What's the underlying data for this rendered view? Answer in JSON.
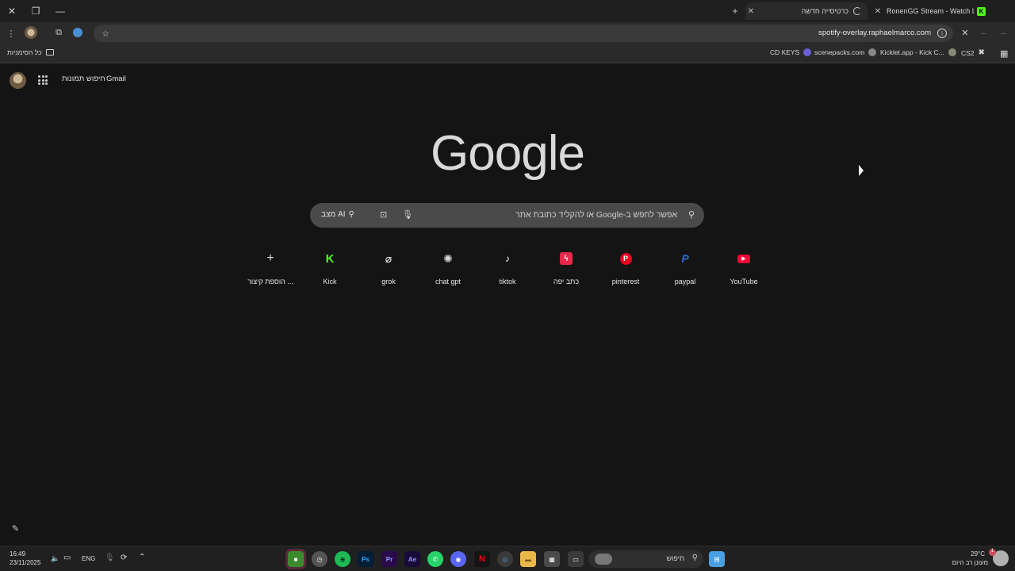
{
  "browser": {
    "tabs": [
      {
        "title": "RonenGG Stream - Watch Live",
        "active": false
      },
      {
        "title": "כרטיסייה חדשה",
        "active": true
      }
    ],
    "window_controls": {
      "close": "✕",
      "restore": "❐",
      "minimize": "—"
    },
    "new_tab": "+",
    "url": "spotify-overlay.raphaelmarco.com",
    "bookmarks": [
      {
        "label": "CD KEYS",
        "color": "#6b5fd6"
      },
      {
        "label": "scenepacks.com",
        "color": "#888888"
      },
      {
        "label": "Kicklet.app - Kick C...",
        "color": "#8a8a7a"
      },
      {
        "label": "CS2",
        "color": "#cccccc"
      }
    ],
    "all_bookmarks": "כל הסימניות"
  },
  "google": {
    "gmail": "Gmail",
    "images": "חיפוש תמונות",
    "logo": "Google",
    "search_placeholder": "אפשר לחפש ב-Google או להקליד כתובת אתר",
    "ai_mode": "מצב AI",
    "shortcuts": [
      {
        "label": "YouTube",
        "icon": "youtube-icon",
        "glyph": "▶",
        "color": "#ff0033",
        "bg": "#2a2a2a"
      },
      {
        "label": "paypal",
        "icon": "paypal-icon",
        "glyph": "P",
        "color": "#2c6bd4",
        "bg": "#2a2a2a"
      },
      {
        "label": "pinterest",
        "icon": "pinterest-icon",
        "glyph": "P",
        "color": "#e60023",
        "bg": "#2a2a2a"
      },
      {
        "label": "כתב יפה",
        "icon": "lightning-icon",
        "glyph": "ϟ",
        "color": "#ff3355",
        "bg": "#2a2a2a"
      },
      {
        "label": "tiktok",
        "icon": "tiktok-icon",
        "glyph": "♪",
        "color": "#ffffff",
        "bg": "#2a2a2a"
      },
      {
        "label": "chat gpt",
        "icon": "chatgpt-icon",
        "glyph": "✺",
        "color": "#dddddd",
        "bg": "#2a2a2a"
      },
      {
        "label": "grok",
        "icon": "grok-icon",
        "glyph": "⌀",
        "color": "#dddddd",
        "bg": "#2a2a2a"
      },
      {
        "label": "Kick",
        "icon": "kick-icon",
        "glyph": "K",
        "color": "#53fc18",
        "bg": "#2a2a2a"
      },
      {
        "label": "הוספת קיצור ...",
        "icon": "plus-icon",
        "glyph": "+",
        "color": "#dddddd",
        "bg": "#2a2a2a"
      }
    ]
  },
  "taskbar": {
    "time": "16:49",
    "date": "23/11/2025",
    "lang": "ENG",
    "search_label": "חיפוש",
    "weather_temp": "29°C",
    "weather_text": "מעונן רב היום",
    "apps": [
      {
        "name": "minecraft",
        "glyph": "■",
        "color": "#3c8a2e"
      },
      {
        "name": "clock",
        "glyph": "◷",
        "color": "#555555"
      },
      {
        "name": "spotify",
        "glyph": "≋",
        "color": "#1db954"
      },
      {
        "name": "photoshop",
        "glyph": "Ps",
        "color": "#001e36"
      },
      {
        "name": "premiere",
        "glyph": "Pr",
        "color": "#2a0a4a"
      },
      {
        "name": "after-effects",
        "glyph": "Ae",
        "color": "#1a0a3a"
      },
      {
        "name": "whatsapp",
        "glyph": "✆",
        "color": "#25d366"
      },
      {
        "name": "discord",
        "glyph": "◉",
        "color": "#5865f2"
      },
      {
        "name": "netflix",
        "glyph": "N",
        "color": "#141414"
      },
      {
        "name": "chrome",
        "glyph": "◎",
        "color": "#3a3a3a"
      },
      {
        "name": "file-explorer",
        "glyph": "▬",
        "color": "#e8b84a"
      },
      {
        "name": "calculator",
        "glyph": "▦",
        "color": "#4a4a4a"
      },
      {
        "name": "task-view",
        "glyph": "▭",
        "color": "#3a3a3a"
      }
    ]
  }
}
